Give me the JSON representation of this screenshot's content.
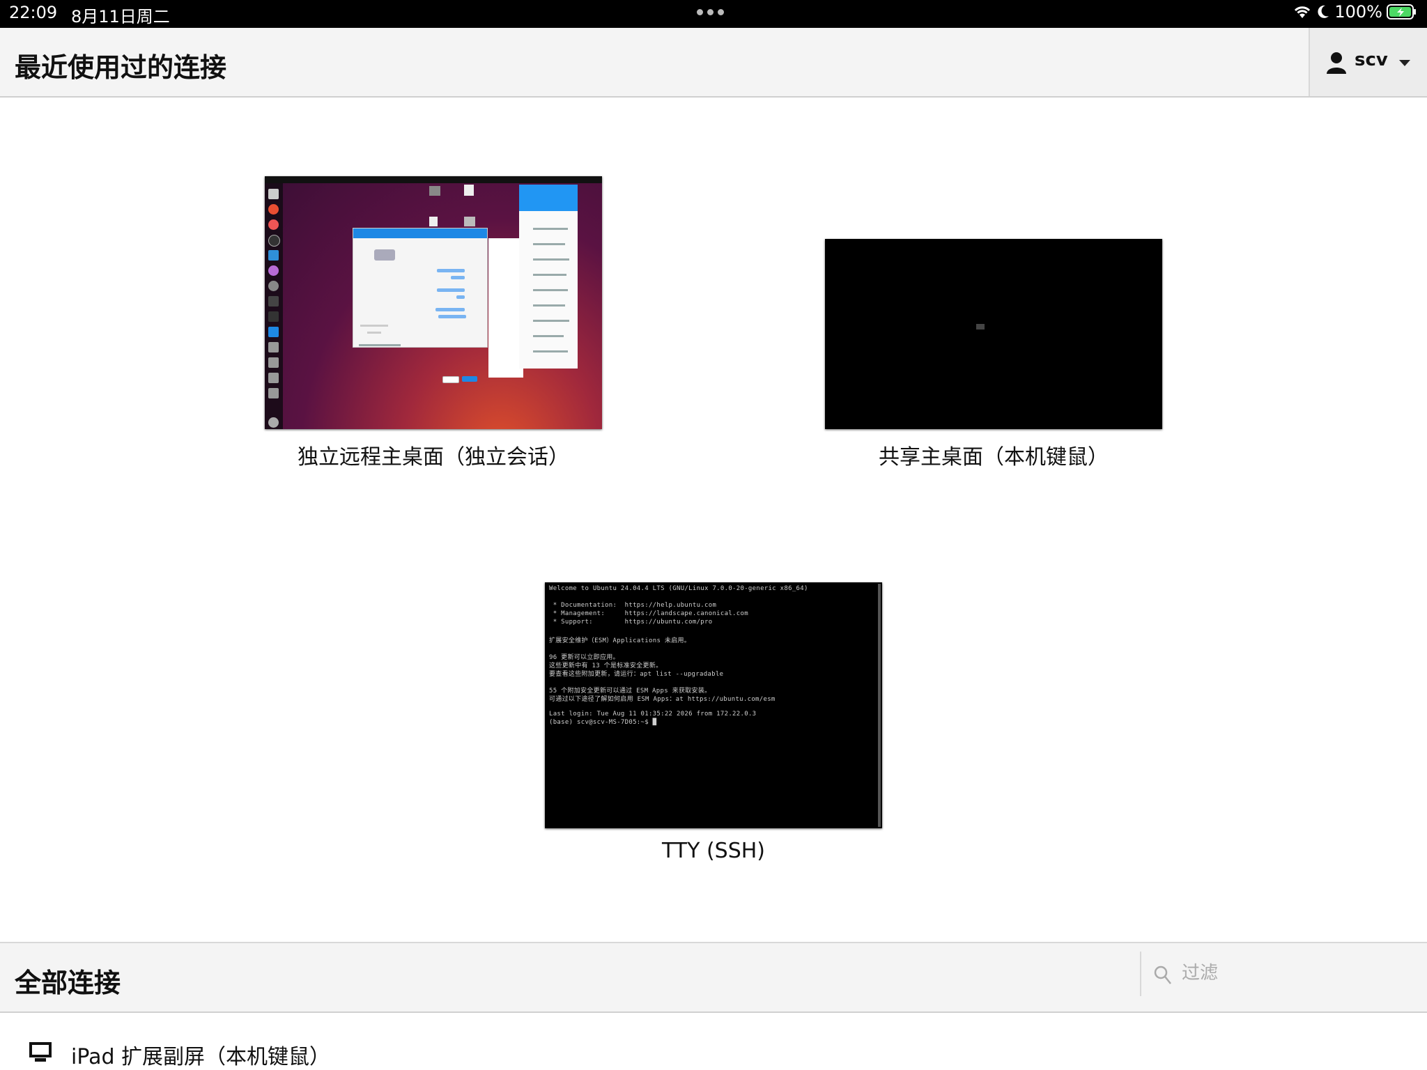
{
  "status_bar": {
    "time": "22:09",
    "date": "8月11日周二",
    "battery": "100%",
    "icons": [
      "wifi-icon",
      "moon-icon",
      "battery-icon"
    ]
  },
  "header": {
    "title": "最近使用过的连接",
    "user": "scv"
  },
  "recent": [
    {
      "caption": "独立远程主桌面（独立会话）",
      "thumb": "ubuntu-desktop"
    },
    {
      "caption": "共享主桌面（本机键鼠）",
      "thumb": "black-screen"
    },
    {
      "caption": "TTY (SSH)",
      "thumb": "terminal"
    }
  ],
  "terminal_lines": [
    "Welcome to Ubuntu 24.04.4 LTS (GNU/Linux 7.0.0-20-generic x86_64)",
    "",
    " * Documentation:  https://help.ubuntu.com",
    " * Management:     https://landscape.canonical.com",
    " * Support:        https://ubuntu.com/pro",
    "",
    "扩展安全维护（ESM）Applications 未启用。",
    "",
    "96 更新可以立即应用。",
    "这些更新中有 13 个是标准安全更新。",
    "要查看这些附加更新，请运行：apt list --upgradable",
    "",
    "55 个附加安全更新可以通过 ESM Apps 来获取安装。",
    "可通过以下途径了解如何启用 ESM Apps：at https://ubuntu.com/esm",
    "",
    "Last login: Tue Aug 11 01:35:22 2026 from 172.22.0.3",
    "(base) scv@scv-MS-7D05:~$ █"
  ],
  "all_connections": {
    "title": "全部连接",
    "filter_placeholder": "过滤",
    "items": [
      {
        "label": "iPad 扩展副屏（本机键鼠）",
        "icon": "monitor-icon"
      }
    ]
  }
}
